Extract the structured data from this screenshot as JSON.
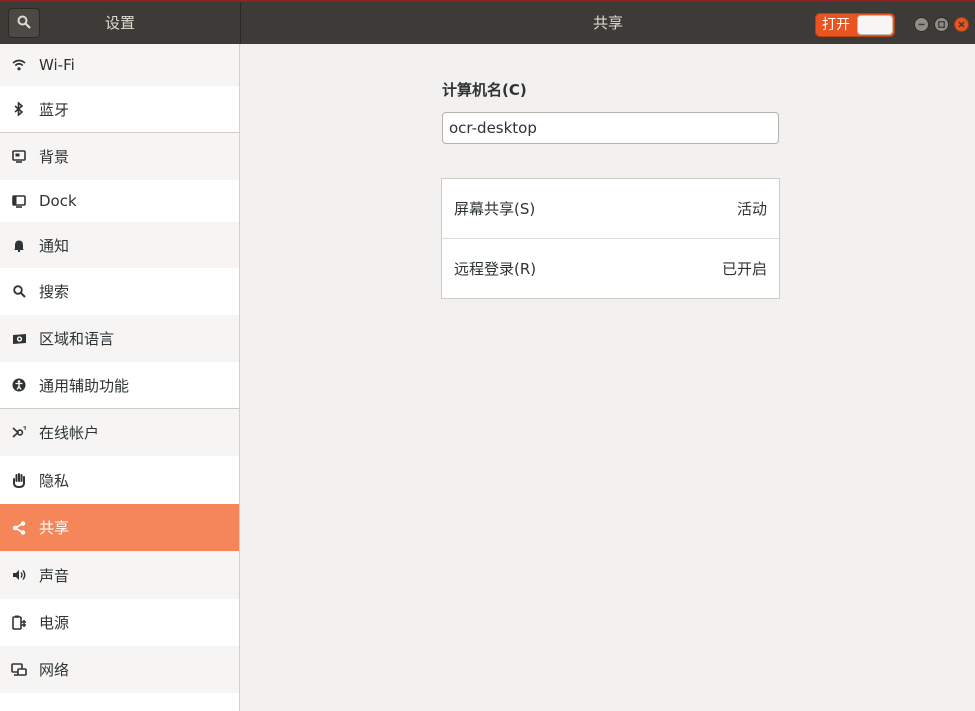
{
  "header": {
    "sidebar_title": "设置",
    "page_title": "共享",
    "switch_label": "打开"
  },
  "sidebar": {
    "items": [
      {
        "label": "Wi-Fi",
        "icon": "wifi-icon"
      },
      {
        "label": "蓝牙",
        "icon": "bluetooth-icon"
      },
      {
        "label": "背景",
        "icon": "background-icon"
      },
      {
        "label": "Dock",
        "icon": "dock-icon"
      },
      {
        "label": "通知",
        "icon": "bell-icon"
      },
      {
        "label": "搜索",
        "icon": "search-icon"
      },
      {
        "label": "区域和语言",
        "icon": "region-icon"
      },
      {
        "label": "通用辅助功能",
        "icon": "accessibility-icon"
      },
      {
        "label": "在线帐户",
        "icon": "online-accounts-icon"
      },
      {
        "label": "隐私",
        "icon": "hand-icon"
      },
      {
        "label": "共享",
        "icon": "share-icon",
        "active": true
      },
      {
        "label": "声音",
        "icon": "speaker-icon"
      },
      {
        "label": "电源",
        "icon": "power-icon"
      },
      {
        "label": "网络",
        "icon": "network-icon"
      }
    ]
  },
  "main": {
    "computer_name_label": "计算机名(C)",
    "computer_name_value": "ocr-desktop",
    "rows": [
      {
        "label": "屏幕共享(S)",
        "status": "活动"
      },
      {
        "label": "远程登录(R)",
        "status": "已开启"
      }
    ]
  },
  "colors": {
    "accent": "#e95420",
    "active_item": "#f4865a",
    "header_bg": "#3c3b37"
  }
}
